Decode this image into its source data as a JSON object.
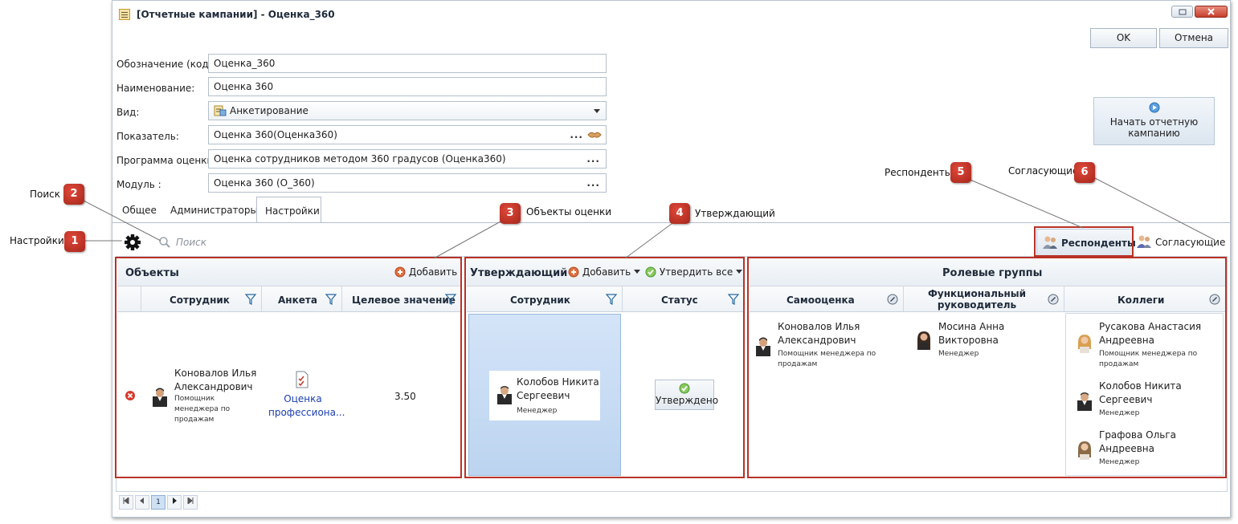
{
  "window": {
    "title": "[Отчетные кампании] - Оценка_360",
    "ok_label": "OK",
    "cancel_label": "Отмена"
  },
  "form": {
    "code_label": "Обозначение (код):",
    "code_value": "Оценка_360",
    "name_label": "Наименование:",
    "name_value": "Оценка 360",
    "kind_label": "Вид:",
    "kind_value": "Анкетирование",
    "indicator_label": "Показатель:",
    "indicator_value": "Оценка 360(Оценка360)",
    "program_label": "Программа оценки :",
    "program_value": "Оценка сотрудников методом 360 градусов (Оценка360)",
    "module_label": "Модуль :",
    "module_value": "Оценка 360 (О_360)"
  },
  "start_button": {
    "line1": "Начать отчетную",
    "line2": "кампанию"
  },
  "tabs": [
    {
      "label": "Общее"
    },
    {
      "label": "Администраторы"
    },
    {
      "label": "Настройки"
    }
  ],
  "toolbar": {
    "search_placeholder": "Поиск",
    "respondents_label": "Респонденты",
    "approvers_label": "Согласующие"
  },
  "objects_panel": {
    "title": "Объекты",
    "add_label": "Добавить",
    "columns": [
      "Сотрудник",
      "Анкета",
      "Целевое значение"
    ],
    "row": {
      "name_line1": "Коновалов Илья",
      "name_line2": "Александрович",
      "role_line1": "Помощник",
      "role_line2": "менеджера по",
      "role_line3": "продажам",
      "questionnaire_line1": "Оценка",
      "questionnaire_line2": "профессиона...",
      "target": "3.50"
    }
  },
  "approver_panel": {
    "title": "Утверждающий",
    "add_label": "Добавить",
    "approve_all_label": "Утвердить все",
    "columns": [
      "Сотрудник",
      "Статус"
    ],
    "row": {
      "name_line1": "Колобов Никита",
      "name_line2": "Сергеевич",
      "role": "Менеджер",
      "status": "Утверждено"
    }
  },
  "roles_panel": {
    "title": "Ролевые группы",
    "columns": [
      "Самооценка",
      "Функциональный руководитель",
      "Коллеги"
    ],
    "self": {
      "name_line1": "Коновалов Илья",
      "name_line2": "Александрович",
      "role_line1": "Помощник менеджера по",
      "role_line2": "продажам"
    },
    "manager": {
      "name_line1": "Мосина Анна",
      "name_line2": "Викторовна",
      "role": "Менеджер"
    },
    "colleagues": [
      {
        "name_line1": "Русакова Анастасия",
        "name_line2": "Андреевна",
        "role_line1": "Помощник менеджера по",
        "role_line2": "продажам"
      },
      {
        "name_line1": "Колобов Никита",
        "name_line2": "Сергеевич",
        "role_line1": "Менеджер",
        "role_line2": ""
      },
      {
        "name_line1": "Графова Ольга",
        "name_line2": "Андреевна",
        "role_line1": "Менеджер",
        "role_line2": ""
      }
    ]
  },
  "pager": {
    "current_page": "1"
  },
  "callouts": [
    {
      "number": "1",
      "label": "Настройки"
    },
    {
      "number": "2",
      "label": "Поиск"
    },
    {
      "number": "3",
      "label": "Объекты оценки"
    },
    {
      "number": "4",
      "label": "Утверждающий"
    },
    {
      "number": "5",
      "label": "Респонденты"
    },
    {
      "number": "6",
      "label": "Согласующие"
    }
  ],
  "colors": {
    "accent_red": "#b83227",
    "header_bg": "#e8eef4",
    "selected_cell": "#c8dcf4",
    "link_blue": "#1a3fb0"
  }
}
